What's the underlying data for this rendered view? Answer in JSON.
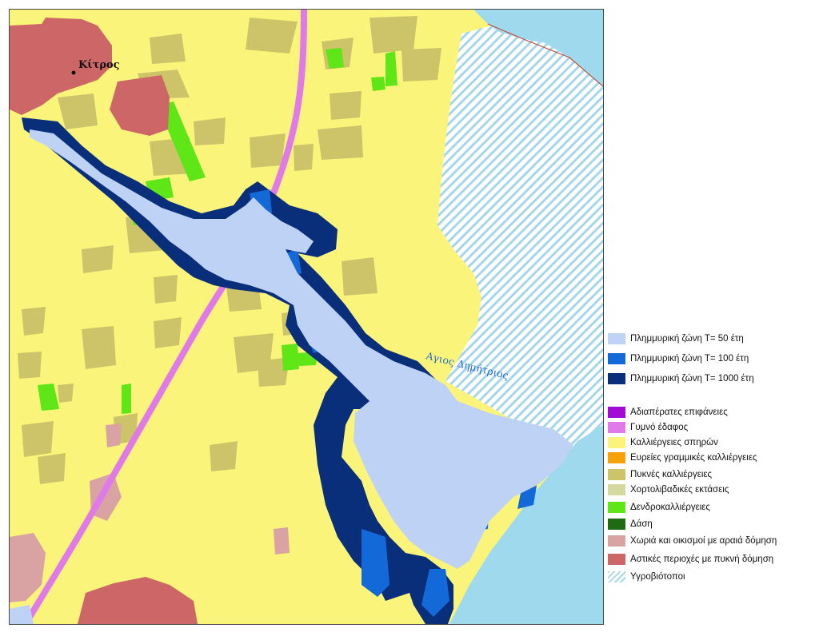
{
  "map": {
    "place_labels": {
      "kitros": "Κίτρος",
      "agios_dimitrios": "Αγιος Δημήτριος"
    }
  },
  "legend": {
    "flood_zones": [
      {
        "label": "Πλημμυρική ζώνη Τ= 50 έτη",
        "color": "#bed2f5",
        "icon": "flood-zone-50-swatch"
      },
      {
        "label": "Πλημμυρική ζώνη Τ= 100 έτη",
        "color": "#1469d8",
        "icon": "flood-zone-100-swatch"
      },
      {
        "label": "Πλημμυρική ζώνη Τ= 1000 έτη",
        "color": "#0a2f7a",
        "icon": "flood-zone-1000-swatch"
      }
    ],
    "land_use": [
      {
        "label": "Αδιαπέρατες επιφάνειες",
        "color": "#a20ad6",
        "icon": "impervious-swatch"
      },
      {
        "label": "Γυμνό έδαφος",
        "color": "#e07ae8",
        "icon": "bare-soil-swatch"
      },
      {
        "label": "Καλλιέργειες σπηρών",
        "color": "#fbf47a",
        "icon": "cereal-crops-swatch"
      },
      {
        "label": "Ευρείες γραμμικές καλλιέργειες",
        "color": "#f5a10a",
        "icon": "broad-row-crops-swatch"
      },
      {
        "label": "Πυκνές καλλιέργειες",
        "color": "#cdc46a",
        "icon": "dense-crops-swatch"
      },
      {
        "label": "Χορτολιβαδικές εκτάσεις",
        "color": "#d3d9a0",
        "icon": "grassland-swatch"
      },
      {
        "label": "Δενδροκαλλιέργειες",
        "color": "#5ee617",
        "icon": "orchards-swatch"
      },
      {
        "label": "Δάση",
        "color": "#1f6b12",
        "icon": "forest-swatch"
      },
      {
        "label": "Χωριά και οικισμοί με αραιά δόμηση",
        "color": "#d9a3a3",
        "icon": "sparse-settlement-swatch"
      },
      {
        "label": "Αστικές περιοχές με πυκνή δόμηση",
        "color": "#cd6767",
        "icon": "dense-urban-swatch"
      },
      {
        "label": "Υγροβιότοποι",
        "color": "hatch",
        "icon": "wetland-swatch"
      }
    ]
  }
}
